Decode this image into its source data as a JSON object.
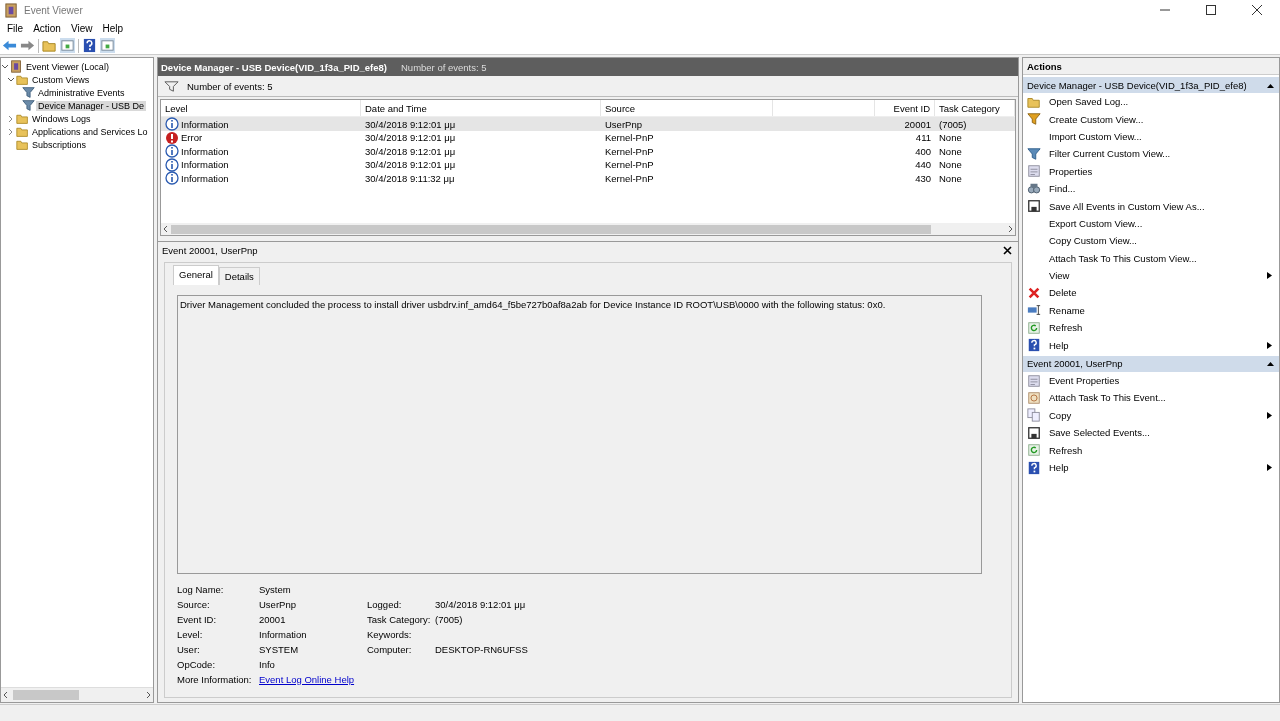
{
  "window": {
    "title": "Event Viewer"
  },
  "menu": [
    "File",
    "Action",
    "View",
    "Help"
  ],
  "tree": [
    {
      "label": "Event Viewer (Local)",
      "kind": "viewer",
      "selected": false,
      "expanded": true,
      "children": [
        {
          "label": "Custom Views",
          "kind": "folder",
          "selected": false,
          "expanded": true,
          "children": [
            {
              "label": "Administrative Events",
              "kind": "filter",
              "selected": false
            },
            {
              "label": "Device Manager - USB De",
              "kind": "filter",
              "selected": true
            }
          ]
        },
        {
          "label": "Windows Logs",
          "kind": "folder",
          "selected": false,
          "expanded": false
        },
        {
          "label": "Applications and Services Lo",
          "kind": "folder",
          "selected": false,
          "expanded": false
        },
        {
          "label": "Subscriptions",
          "kind": "folder",
          "selected": false
        }
      ]
    }
  ],
  "view_header": {
    "title": "Device Manager - USB Device(VID_1f3a_PID_efe8)",
    "count": "Number of events: 5"
  },
  "filter_bar": {
    "text": "Number of events: 5"
  },
  "table": {
    "columns": [
      "Level",
      "Date and Time",
      "Source",
      "Event ID",
      "Task Category"
    ],
    "rows": [
      {
        "kind": "info",
        "selected": true,
        "cells": [
          "Information",
          "30/4/2018 9:12:01 μμ",
          "UserPnp",
          "20001",
          "(7005)"
        ]
      },
      {
        "kind": "error",
        "selected": false,
        "cells": [
          "Error",
          "30/4/2018 9:12:01 μμ",
          "Kernel-PnP",
          "411",
          "None"
        ]
      },
      {
        "kind": "info",
        "selected": false,
        "cells": [
          "Information",
          "30/4/2018 9:12:01 μμ",
          "Kernel-PnP",
          "400",
          "None"
        ]
      },
      {
        "kind": "info",
        "selected": false,
        "cells": [
          "Information",
          "30/4/2018 9:12:01 μμ",
          "Kernel-PnP",
          "440",
          "None"
        ]
      },
      {
        "kind": "info",
        "selected": false,
        "cells": [
          "Information",
          "30/4/2018 9:11:32 μμ",
          "Kernel-PnP",
          "430",
          "None"
        ]
      }
    ]
  },
  "details": {
    "title": "Event 20001, UserPnp",
    "tabs": [
      {
        "label": "General",
        "selected": true
      },
      {
        "label": "Details",
        "selected": false
      }
    ],
    "message": "Driver Management concluded the process to install driver usbdrv.inf_amd64_f5be727b0af8a2ab for Device Instance ID ROOT\\USB\\0000 with the following status: 0x0.",
    "rows": [
      {
        "cells": [
          {
            "label": "Log Name:",
            "value": "System"
          }
        ]
      },
      {
        "cells": [
          {
            "label": "Source:",
            "value": "UserPnp"
          },
          {
            "label": "Logged:",
            "value": "30/4/2018 9:12:01 μμ"
          }
        ]
      },
      {
        "cells": [
          {
            "label": "Event ID:",
            "value": "20001"
          },
          {
            "label": "Task Category:",
            "value": "(7005)"
          }
        ]
      },
      {
        "cells": [
          {
            "label": "Level:",
            "value": "Information"
          },
          {
            "label": "Keywords:"
          }
        ]
      },
      {
        "cells": [
          {
            "label": "User:",
            "value": "SYSTEM"
          },
          {
            "label": "Computer:",
            "value": "DESKTOP-RN6UFSS"
          }
        ]
      },
      {
        "cells": [
          {
            "label": "OpCode:",
            "value": "Info"
          }
        ]
      },
      {
        "cells": [
          {
            "label": "More Information:",
            "link": "Event Log Online Help"
          }
        ]
      }
    ]
  },
  "actions": {
    "title": "Actions",
    "sections": [
      {
        "title": "Device Manager - USB Device(VID_1f3a_PID_efe8)",
        "expanded": true,
        "items": [
          {
            "label": "Open Saved Log...",
            "kind": "open"
          },
          {
            "label": "Create Custom View...",
            "kind": "funnel"
          },
          {
            "label": "Import Custom View...",
            "kind": "none"
          },
          {
            "label": "Filter Current Custom View...",
            "kind": "filter"
          },
          {
            "label": "Properties",
            "kind": "properties"
          },
          {
            "label": "Find...",
            "kind": "find"
          },
          {
            "label": "Save All Events in Custom View As...",
            "kind": "save"
          },
          {
            "label": "Export Custom View...",
            "kind": "none"
          },
          {
            "label": "Copy Custom View...",
            "kind": "none"
          },
          {
            "label": "Attach Task To This Custom View...",
            "kind": "none"
          },
          {
            "label": "View",
            "kind": "none",
            "submenu": true
          },
          {
            "label": "Delete",
            "kind": "delete"
          },
          {
            "label": "Rename",
            "kind": "rename"
          },
          {
            "label": "Refresh",
            "kind": "refresh"
          },
          {
            "label": "Help",
            "kind": "help",
            "submenu": true
          }
        ]
      },
      {
        "title": "Event 20001, UserPnp",
        "expanded": true,
        "items": [
          {
            "label": "Event Properties",
            "kind": "properties"
          },
          {
            "label": "Attach Task To This Event...",
            "kind": "task"
          },
          {
            "label": "Copy",
            "kind": "copy",
            "submenu": true
          },
          {
            "label": "Save Selected Events...",
            "kind": "save"
          },
          {
            "label": "Refresh",
            "kind": "refresh"
          },
          {
            "label": "Help",
            "kind": "help",
            "submenu": true
          }
        ]
      }
    ]
  }
}
